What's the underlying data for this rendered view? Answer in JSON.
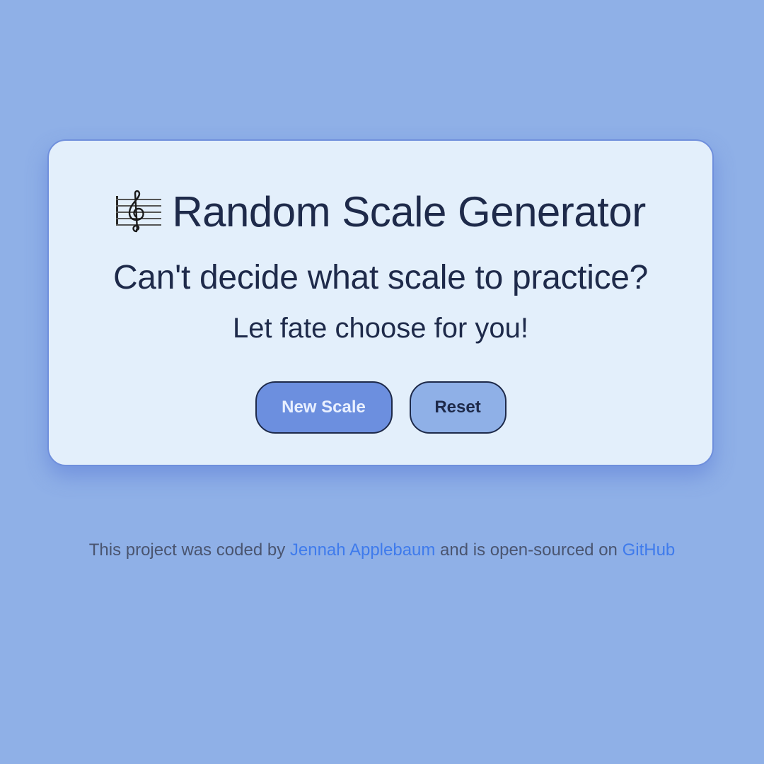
{
  "card": {
    "title_emoji": "🎼",
    "title": "Random Scale Generator",
    "subtitle": "Can't decide what scale to practice?",
    "tagline": "Let fate choose for you!",
    "buttons": {
      "new_scale": "New Scale",
      "reset": "Reset"
    }
  },
  "footer": {
    "text_1": "This project was coded by",
    "author_link": "Jennah Applebaum",
    "text_2": "and is open-sourced on",
    "github_link": "GitHub"
  },
  "colors": {
    "background": "#8fb0e7",
    "card_background": "#e3effb",
    "primary_button": "#6c8fdf",
    "link": "#3f7bec",
    "text_dark": "#1e2a4a"
  }
}
